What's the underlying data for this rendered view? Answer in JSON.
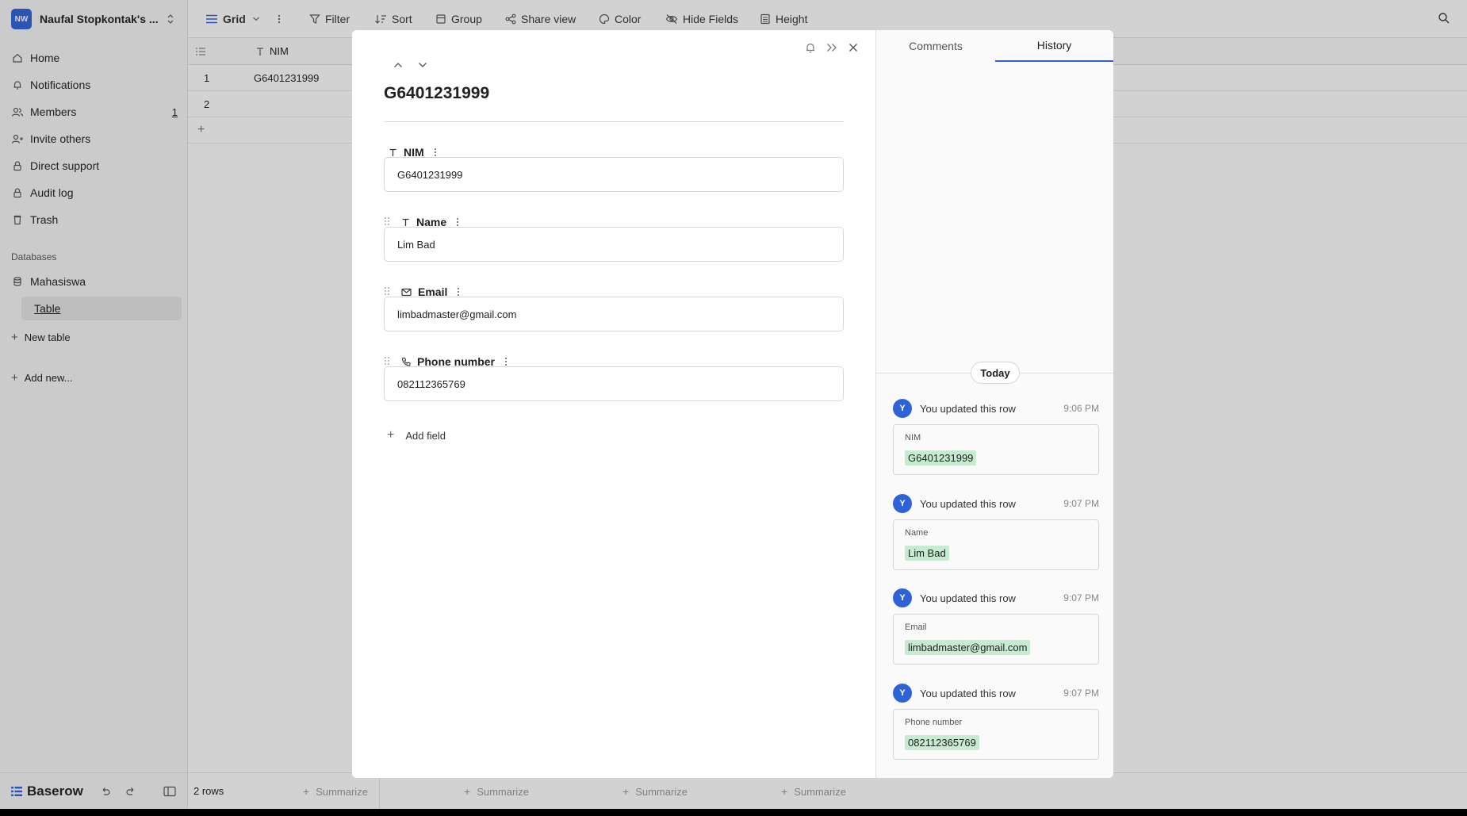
{
  "workspace": {
    "avatar_text": "NW",
    "name": "Naufal Stopkontak's ..."
  },
  "sidebar": {
    "items": [
      {
        "label": "Home"
      },
      {
        "label": "Notifications"
      },
      {
        "label": "Members",
        "count": "1"
      },
      {
        "label": "Invite others"
      },
      {
        "label": "Direct support"
      },
      {
        "label": "Audit log"
      },
      {
        "label": "Trash"
      }
    ],
    "databases_label": "Databases",
    "database": {
      "label": "Mahasiswa",
      "table": "Table"
    },
    "new_table": "New table",
    "add_new": "Add new...",
    "brand": "Baserow"
  },
  "toolbar": {
    "view": "Grid",
    "filter": "Filter",
    "sort": "Sort",
    "group": "Group",
    "share": "Share view",
    "color": "Color",
    "hide": "Hide Fields",
    "height": "Height"
  },
  "grid": {
    "column": "NIM",
    "rows": [
      {
        "num": "1",
        "nim": "G6401231999"
      },
      {
        "num": "2",
        "nim": ""
      }
    ],
    "row_count": "2 rows",
    "summarize": "Summarize"
  },
  "modal": {
    "title": "G6401231999",
    "fields": [
      {
        "label": "NIM",
        "value": "G6401231999",
        "icon": "text-icon"
      },
      {
        "label": "Name",
        "value": "Lim Bad",
        "icon": "text-icon"
      },
      {
        "label": "Email",
        "value": "limbadmaster@gmail.com",
        "icon": "mail-icon"
      },
      {
        "label": "Phone number",
        "value": "082112365769",
        "icon": "phone-icon"
      }
    ],
    "add_field": "Add field",
    "tabs": {
      "comments": "Comments",
      "history": "History"
    },
    "today": "Today",
    "history": [
      {
        "avatar": "Y",
        "text": "You updated this row",
        "time": "9:06 PM",
        "field": "NIM",
        "value": "G6401231999"
      },
      {
        "avatar": "Y",
        "text": "You updated this row",
        "time": "9:07 PM",
        "field": "Name",
        "value": "Lim Bad"
      },
      {
        "avatar": "Y",
        "text": "You updated this row",
        "time": "9:07 PM",
        "field": "Email",
        "value": "limbadmaster@gmail.com"
      },
      {
        "avatar": "Y",
        "text": "You updated this row",
        "time": "9:07 PM",
        "field": "Phone number",
        "value": "082112365769"
      }
    ]
  },
  "colors": {
    "accent": "#2e63d8",
    "changed_value_bg": "#c7ebd0"
  }
}
